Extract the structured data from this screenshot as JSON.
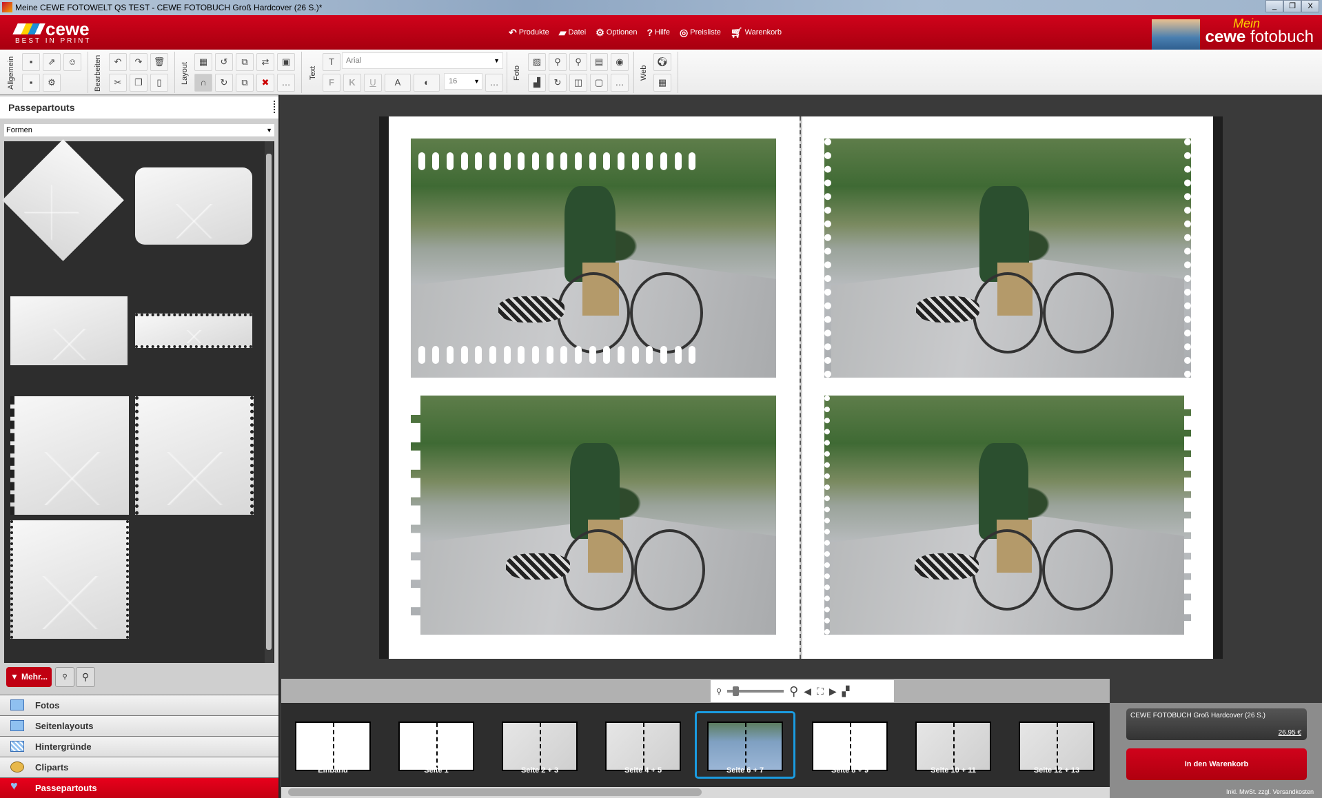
{
  "window": {
    "title": "Meine CEWE FOTOWELT QS TEST - CEWE FOTOBUCH Groß Hardcover  (26 S.)*",
    "controls": [
      "_",
      "❐",
      "X"
    ]
  },
  "header": {
    "logo_word": "cewe",
    "logo_tag": "BEST IN PRINT",
    "brand_mein": "Mein",
    "brand_cewe": "cewe",
    "brand_fotobuch": "fotobuch",
    "menu": [
      {
        "icon": "products-icon",
        "label": "Produkte"
      },
      {
        "icon": "file-icon",
        "label": "Datei"
      },
      {
        "icon": "options-gear-icon",
        "label": "Optionen"
      },
      {
        "icon": "help-icon",
        "label": "Hilfe"
      },
      {
        "icon": "pricelist-icon",
        "label": "Preisliste"
      },
      {
        "icon": "cart-icon",
        "label": "Warenkorb"
      }
    ]
  },
  "toolbar": {
    "groups": [
      "Allgemein",
      "Bearbeiten",
      "Layout",
      "Text",
      "Foto",
      "Web"
    ],
    "font": "Arial",
    "font_size": "16",
    "bold": "F",
    "italic": "K",
    "underline": "U",
    "text_color": "A"
  },
  "left_panel": {
    "title": "Passepartouts",
    "filter": "Formen",
    "more_button": "Mehr...",
    "nav": [
      {
        "label": "Fotos"
      },
      {
        "label": "Seitenlayouts"
      },
      {
        "label": "Hintergründe"
      },
      {
        "label": "Cliparts"
      },
      {
        "label": "Passepartouts",
        "active": true
      }
    ]
  },
  "thumbnails": [
    {
      "label": "Einband"
    },
    {
      "label": "Seite 1"
    },
    {
      "label": "Seite 2 + 3"
    },
    {
      "label": "Seite 4 + 5"
    },
    {
      "label": "Seite 6 + 7",
      "selected": true
    },
    {
      "label": "Seite 8 + 9"
    },
    {
      "label": "Seite 10 + 11"
    },
    {
      "label": "Seite 12 + 13"
    }
  ],
  "order": {
    "product": "CEWE FOTOBUCH Groß Hardcover  (26 S.)",
    "price": "26,95 €",
    "cart_button": "In den Warenkorb",
    "note": "Inkl. MwSt. zzgl. Versandkosten"
  },
  "colors": {
    "brand_red": "#c8001a",
    "selection_blue": "#1a9be0",
    "canvas": "#3a3a3a"
  }
}
